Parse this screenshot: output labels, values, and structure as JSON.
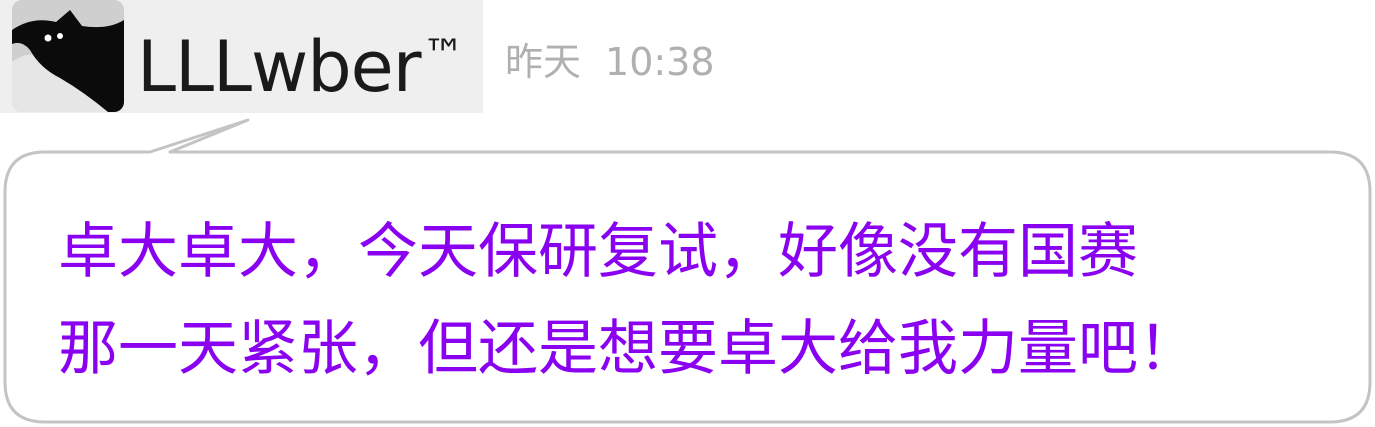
{
  "message": {
    "sender": {
      "name": "LLLwber",
      "trademark": "™",
      "avatar_icon": "cat-avatar-icon"
    },
    "time": {
      "day": "昨天",
      "clock": "10:38"
    },
    "text_lines": [
      "卓大卓大，今天保研复试，好像没有国赛",
      "那一天紧张，但还是想要卓大给我力量吧！"
    ]
  },
  "colors": {
    "message_text": "#8a00f0",
    "timestamp": "#b0b0b0",
    "bubble_border": "#c4c4c4",
    "header_background": "#efefef"
  }
}
